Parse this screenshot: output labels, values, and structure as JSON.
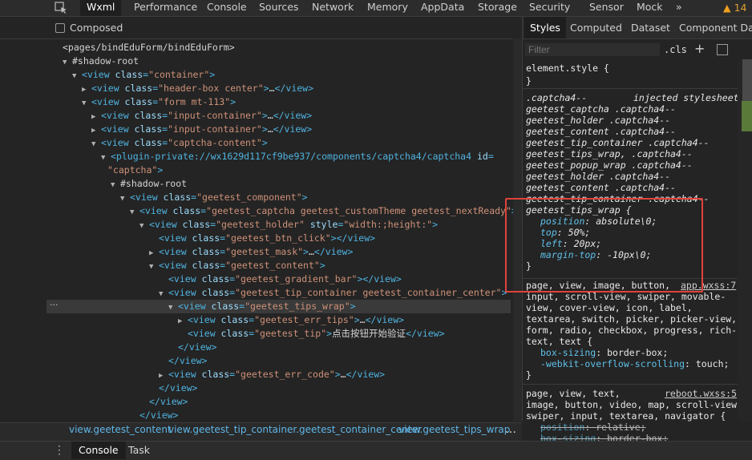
{
  "top_tabs": [
    "Wxml",
    "Performance",
    "Console",
    "Sources",
    "Network",
    "Memory",
    "AppData",
    "Storage",
    "Security",
    "Sensor",
    "Mock",
    "»"
  ],
  "warnings": {
    "icon": "warning-icon",
    "count": "14"
  },
  "composed_label": "Composed",
  "tree": [
    {
      "indent": 0,
      "parts": [
        [
          "plain",
          "<pages/bindEduForm/bindEduForm>"
        ]
      ]
    },
    {
      "indent": 1,
      "arrow": "▼",
      "parts": [
        [
          "plain",
          "#shadow-root"
        ]
      ]
    },
    {
      "indent": 2,
      "arrow": "▼",
      "parts": [
        [
          "tag",
          "<view "
        ],
        [
          "attr",
          "class"
        ],
        [
          "tag",
          "="
        ],
        [
          "val",
          "\"container\""
        ],
        [
          "tag",
          ">"
        ]
      ]
    },
    {
      "indent": 3,
      "arrow": "▶",
      "parts": [
        [
          "tag",
          "<view "
        ],
        [
          "attr",
          "class"
        ],
        [
          "tag",
          "="
        ],
        [
          "val",
          "\"header-box center\""
        ],
        [
          "tag",
          ">"
        ],
        [
          "plain",
          "…"
        ],
        [
          "tag",
          "</view>"
        ]
      ]
    },
    {
      "indent": 3,
      "arrow": "▼",
      "parts": [
        [
          "tag",
          "<view "
        ],
        [
          "attr",
          "class"
        ],
        [
          "tag",
          "="
        ],
        [
          "val",
          "\"form mt-113\""
        ],
        [
          "tag",
          ">"
        ]
      ]
    },
    {
      "indent": 4,
      "arrow": "▶",
      "parts": [
        [
          "tag",
          "<view "
        ],
        [
          "attr",
          "class"
        ],
        [
          "tag",
          "="
        ],
        [
          "val",
          "\"input-container\""
        ],
        [
          "tag",
          ">"
        ],
        [
          "plain",
          "…"
        ],
        [
          "tag",
          "</view>"
        ]
      ]
    },
    {
      "indent": 4,
      "arrow": "▶",
      "parts": [
        [
          "tag",
          "<view "
        ],
        [
          "attr",
          "class"
        ],
        [
          "tag",
          "="
        ],
        [
          "val",
          "\"input-container\""
        ],
        [
          "tag",
          ">"
        ],
        [
          "plain",
          "…"
        ],
        [
          "tag",
          "</view>"
        ]
      ]
    },
    {
      "indent": 4,
      "arrow": "▼",
      "parts": [
        [
          "tag",
          "<view "
        ],
        [
          "attr",
          "class"
        ],
        [
          "tag",
          "="
        ],
        [
          "val",
          "\"captcha-content\""
        ],
        [
          "tag",
          ">"
        ]
      ]
    },
    {
      "indent": 5,
      "arrow": "▼",
      "parts": [
        [
          "tag",
          "<plugin-private://wx1629d117cf9be937/components/captcha4/captcha4 "
        ],
        [
          "attr",
          "id"
        ],
        [
          "tag",
          "="
        ]
      ]
    },
    {
      "indent": 5,
      "continuation": true,
      "parts": [
        [
          "val",
          "\"captcha\""
        ],
        [
          "tag",
          ">"
        ]
      ]
    },
    {
      "indent": 6,
      "arrow": "▼",
      "parts": [
        [
          "plain",
          "#shadow-root"
        ]
      ]
    },
    {
      "indent": 7,
      "arrow": "▼",
      "parts": [
        [
          "tag",
          "<view "
        ],
        [
          "attr",
          "class"
        ],
        [
          "tag",
          "="
        ],
        [
          "val",
          "\"geetest_component\""
        ],
        [
          "tag",
          ">"
        ]
      ]
    },
    {
      "indent": 8,
      "arrow": "▼",
      "parts": [
        [
          "tag",
          "<view "
        ],
        [
          "attr",
          "class"
        ],
        [
          "tag",
          "="
        ],
        [
          "val",
          "\"geetest_captcha geetest_customTheme geetest_nextReady\""
        ],
        [
          "tag",
          ">"
        ]
      ]
    },
    {
      "indent": 9,
      "arrow": "▼",
      "parts": [
        [
          "tag",
          "<view "
        ],
        [
          "attr",
          "class"
        ],
        [
          "tag",
          "="
        ],
        [
          "val",
          "\"geetest_holder\""
        ],
        [
          "tag",
          " "
        ],
        [
          "attr",
          "style"
        ],
        [
          "tag",
          "="
        ],
        [
          "val",
          "\"width:;height:\""
        ],
        [
          "tag",
          ">"
        ]
      ]
    },
    {
      "indent": 10,
      "parts": [
        [
          "tag",
          "<view "
        ],
        [
          "attr",
          "class"
        ],
        [
          "tag",
          "="
        ],
        [
          "val",
          "\"geetest_btn_click\""
        ],
        [
          "tag",
          "></view>"
        ]
      ]
    },
    {
      "indent": 10,
      "arrow": "▶",
      "parts": [
        [
          "tag",
          "<view "
        ],
        [
          "attr",
          "class"
        ],
        [
          "tag",
          "="
        ],
        [
          "val",
          "\"geetest_mask\""
        ],
        [
          "tag",
          ">"
        ],
        [
          "plain",
          "…"
        ],
        [
          "tag",
          "</view>"
        ]
      ]
    },
    {
      "indent": 10,
      "arrow": "▼",
      "parts": [
        [
          "tag",
          "<view "
        ],
        [
          "attr",
          "class"
        ],
        [
          "tag",
          "="
        ],
        [
          "val",
          "\"geetest_content\""
        ],
        [
          "tag",
          ">"
        ]
      ]
    },
    {
      "indent": 11,
      "parts": [
        [
          "tag",
          "<view "
        ],
        [
          "attr",
          "class"
        ],
        [
          "tag",
          "="
        ],
        [
          "val",
          "\"geetest_gradient_bar\""
        ],
        [
          "tag",
          "></view>"
        ]
      ]
    },
    {
      "indent": 11,
      "arrow": "▼",
      "parts": [
        [
          "tag",
          "<view "
        ],
        [
          "attr",
          "class"
        ],
        [
          "tag",
          "="
        ],
        [
          "val",
          "\"geetest_tip_container geetest_container_center\""
        ],
        [
          "tag",
          ">"
        ]
      ]
    },
    {
      "indent": 12,
      "arrow": "▼",
      "selected": true,
      "parts": [
        [
          "tag",
          "<view "
        ],
        [
          "attr",
          "class"
        ],
        [
          "tag",
          "="
        ],
        [
          "val",
          "\"geetest_tips_wrap\""
        ],
        [
          "tag",
          ">"
        ]
      ]
    },
    {
      "indent": 13,
      "arrow": "▶",
      "parts": [
        [
          "tag",
          "<view "
        ],
        [
          "attr",
          "class"
        ],
        [
          "tag",
          "="
        ],
        [
          "val",
          "\"geetest_err_tips\""
        ],
        [
          "tag",
          ">"
        ],
        [
          "plain",
          "…"
        ],
        [
          "tag",
          "</view>"
        ]
      ]
    },
    {
      "indent": 13,
      "parts": [
        [
          "tag",
          "<view "
        ],
        [
          "attr",
          "class"
        ],
        [
          "tag",
          "="
        ],
        [
          "val",
          "\"geetest_tip\""
        ],
        [
          "tag",
          ">"
        ],
        [
          "plain",
          "点击按钮开始验证"
        ],
        [
          "tag",
          "</view>"
        ]
      ]
    },
    {
      "indent": 12,
      "parts": [
        [
          "tag",
          "</view>"
        ]
      ]
    },
    {
      "indent": 11,
      "parts": [
        [
          "tag",
          "</view>"
        ]
      ]
    },
    {
      "indent": 11,
      "arrow": "▶",
      "parts": [
        [
          "tag",
          "<view "
        ],
        [
          "attr",
          "class"
        ],
        [
          "tag",
          "="
        ],
        [
          "val",
          "\"geetest_err_code\""
        ],
        [
          "tag",
          ">"
        ],
        [
          "plain",
          "…"
        ],
        [
          "tag",
          "</view>"
        ]
      ]
    },
    {
      "indent": 10,
      "parts": [
        [
          "tag",
          "</view>"
        ]
      ]
    },
    {
      "indent": 9,
      "parts": [
        [
          "tag",
          "</view>"
        ]
      ]
    },
    {
      "indent": 8,
      "parts": [
        [
          "tag",
          "</view>"
        ]
      ]
    }
  ],
  "sub_tabs": [
    "Styles",
    "Computed",
    "Dataset",
    "Component Data"
  ],
  "filter_placeholder": "Filter",
  "cls_label": ".cls",
  "plus_label": "+",
  "styles": {
    "element_style": "element.style {",
    "element_style_close": "}",
    "rule1_selectors": [
      ".captcha4--",
      "geetest_captcha .captcha4--",
      "geetest_holder .captcha4--",
      "geetest_content .captcha4--",
      "geetest_tip_container .captcha4--",
      "geetest_tips_wrap, .captcha4--",
      "geetest_popup_wrap .captcha4--",
      "geetest_holder .captcha4--",
      "geetest_content .captcha4--",
      "geetest_tip_container .captcha4--",
      "geetest_tips_wrap {"
    ],
    "rule1_source": "injected stylesheet",
    "rule1_props": [
      {
        "name": "position",
        "value": "absolute\\0;"
      },
      {
        "name": "top",
        "value": "50%;"
      },
      {
        "name": "left",
        "value": "20px;"
      },
      {
        "name": "margin-top",
        "value": "-10px\\0;"
      }
    ],
    "rule1_close": "}",
    "rule2_selectors": [
      "page, view, image, button,",
      "input, scroll-view, swiper, movable-",
      "view, cover-view, icon, label,",
      "textarea, switch, picker, picker-view,",
      "form, radio, checkbox, progress, rich-",
      "text, text {"
    ],
    "rule2_source": "app.wxss:7",
    "rule2_props": [
      {
        "name": "box-sizing",
        "value": "border-box;"
      },
      {
        "name": "-webkit-overflow-scrolling",
        "value": "touch;"
      }
    ],
    "rule2_close": "}",
    "rule3_selectors": [
      "page, view, text,",
      "image, button, video, map, scroll-view,",
      "swiper, input, textarea, navigator {"
    ],
    "rule3_source": "reboot.wxss:5",
    "rule3_props": [
      {
        "name": "position",
        "value": "relative;"
      },
      {
        "name": "box-sizing",
        "value": "border-box;"
      }
    ]
  },
  "breadcrumbs": [
    "view.geetest_content",
    "view.geetest_tip_container.geetest_container_center",
    "view.geetest_tips_wrap"
  ],
  "breadcrumb_more": "…",
  "bottom_tabs": [
    "Console",
    "Task"
  ]
}
